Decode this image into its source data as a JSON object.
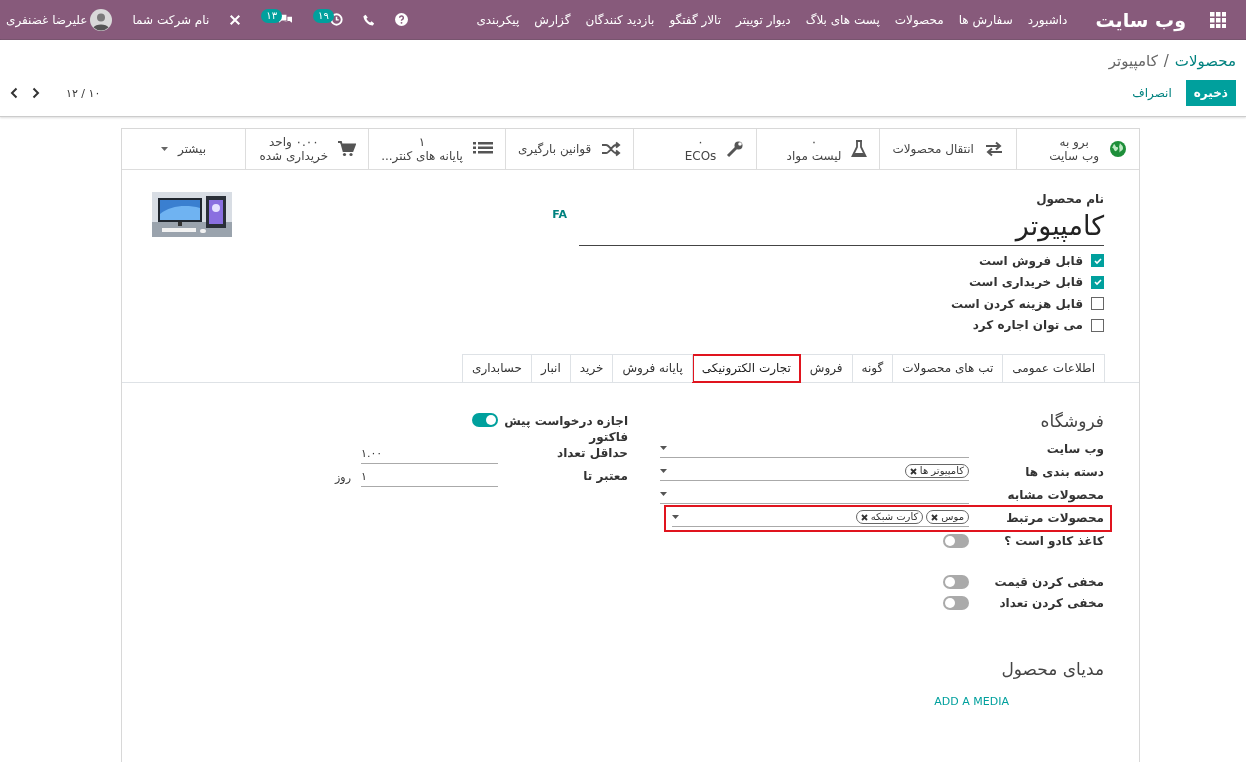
{
  "topbar": {
    "app_title": "وب سایت",
    "menu": [
      "داشبورد",
      "سفارش ها",
      "محصولات",
      "پست های بلاگ",
      "دیوار توییتر",
      "تالار گفتگو",
      "بازدید کنندگان",
      "گزارش",
      "پیکربندی"
    ],
    "systray": [
      {
        "kind": "help"
      },
      {
        "kind": "phone"
      },
      {
        "kind": "activity",
        "count": "۱۹"
      },
      {
        "kind": "chat",
        "count": "۱۳"
      },
      {
        "kind": "tools"
      }
    ],
    "company": "نام شرکت شما",
    "user": "علیرضا غضنفری"
  },
  "breadcrumb": {
    "parent": "محصولات",
    "separator": "/",
    "current": "کامپیوتر"
  },
  "actions": {
    "save": "ذخیره",
    "discard": "انصراف"
  },
  "pager": "۱۰ / ۱۲",
  "button_box": [
    {
      "kind": "globe",
      "value": "برو به",
      "label": "وب سایت"
    },
    {
      "kind": "transfer",
      "label": "انتقال محصولات"
    },
    {
      "kind": "flask",
      "value": "۰",
      "label": "لیست مواد"
    },
    {
      "kind": "wrench",
      "value": "۰",
      "label": "ECOs"
    },
    {
      "kind": "shuffle",
      "label": "قوانین بارگیری"
    },
    {
      "kind": "list",
      "value": "۱",
      "label": "پایانه های کنتر..."
    },
    {
      "kind": "cart",
      "value": "۰.۰۰ واحد",
      "label": "خریداری شده"
    },
    {
      "kind": "more",
      "label": "بیشتر"
    }
  ],
  "product": {
    "name_label": "نام محصول",
    "name": "کامپیوتر",
    "lang": "FA"
  },
  "checkboxes": [
    {
      "label": "قابل فروش است",
      "checked": true
    },
    {
      "label": "قابل خریداری است",
      "checked": true
    },
    {
      "label": "قابل هزینه کردن است",
      "checked": false
    },
    {
      "label": "می توان اجاره کرد",
      "checked": false
    }
  ],
  "tabs": [
    {
      "label": "اطلاعات عمومی",
      "selected": false,
      "highlighted": false
    },
    {
      "label": "تب های محصولات",
      "selected": false,
      "highlighted": false
    },
    {
      "label": "گونه",
      "selected": false,
      "highlighted": false
    },
    {
      "label": "فروش",
      "selected": false,
      "highlighted": false
    },
    {
      "label": "تجارت الکترونیکی",
      "selected": true,
      "highlighted": true
    },
    {
      "label": "پایانه فروش",
      "selected": false,
      "highlighted": false
    },
    {
      "label": "خرید",
      "selected": false,
      "highlighted": false
    },
    {
      "label": "انبار",
      "selected": false,
      "highlighted": false
    },
    {
      "label": "حسابداری",
      "selected": false,
      "highlighted": false
    }
  ],
  "shop": {
    "title": "فروشگاه",
    "fields": [
      {
        "kind": "select",
        "label": "وب سایت",
        "highlighted": false
      },
      {
        "kind": "tags",
        "label": "دسته بندی ها",
        "tags": [
          "کامپیوتر ها"
        ],
        "highlighted": false
      },
      {
        "kind": "select",
        "label": "محصولات مشابه",
        "highlighted": false
      },
      {
        "kind": "tags",
        "label": "محصولات مرتبط",
        "tags": [
          "موس",
          "کارت شبکه"
        ],
        "highlighted": true
      },
      {
        "kind": "toggle",
        "label": "کاغذ کادو است ؟",
        "on": false
      }
    ],
    "display_options": [
      {
        "kind": "toggle",
        "label": "مخفی کردن قیمت",
        "on": false
      },
      {
        "kind": "toggle",
        "label": "مخفی کردن تعداد",
        "on": false
      }
    ]
  },
  "quotation": {
    "fields": [
      {
        "kind": "toggle",
        "label": "اجازه درخواست پیش فاکتور",
        "on": true
      },
      {
        "kind": "number",
        "label": "حداقل تعداد",
        "value": "۱.۰۰"
      },
      {
        "kind": "number",
        "label": "معتبر تا",
        "value": "۱",
        "unit": "روز"
      }
    ]
  },
  "media": {
    "title": "مدیای محصول",
    "link": "ADD A MEDIA"
  }
}
